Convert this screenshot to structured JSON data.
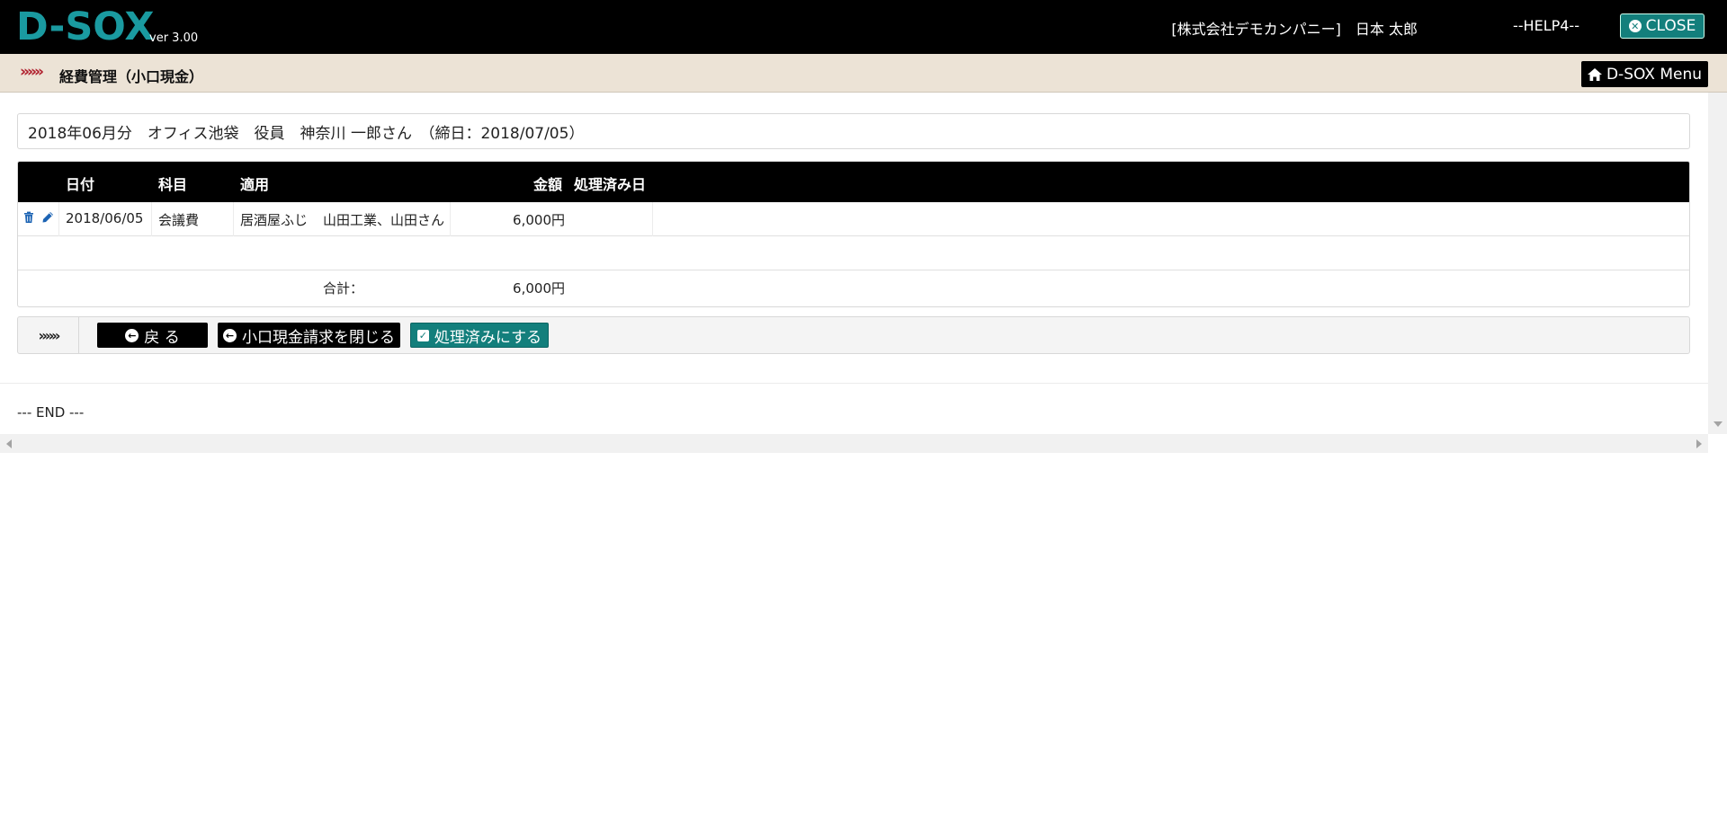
{
  "header": {
    "logo": "D-SOX",
    "version": "ver 3.00",
    "company_user": "[株式会社デモカンパニー]　日本 太郎",
    "help": "--HELP4--",
    "close_label": "CLOSE"
  },
  "breadcrumb": {
    "chevrons": "»»»",
    "title": "経費管理（小口現金）",
    "menu_label": "D-SOX Menu"
  },
  "summary": {
    "text": "2018年06月分　オフィス池袋　役員　神奈川 一郎さん　（締日：2018/07/05）"
  },
  "table": {
    "headers": {
      "date": "日付",
      "subject": "科目",
      "description": "適用",
      "amount": "金額",
      "processed_date": "処理済み日"
    },
    "rows": [
      {
        "date": "2018/06/05",
        "subject": "会議費",
        "description_1": "居酒屋ふじ",
        "description_2": "山田工業、山田さん",
        "amount": "6,000円",
        "processed_date": ""
      }
    ],
    "total_label": "合計：",
    "total_amount": "6,000円"
  },
  "actions": {
    "chevrons": "»»»",
    "back_label": "戻 る",
    "close_request_label": "小口現金請求を閉じる",
    "mark_processed_label": "処理済みにする"
  },
  "footer": {
    "end_text": "--- END ---"
  },
  "colors": {
    "logo": "#1a9aa0",
    "teal_button": "#137f7c",
    "breadcrumb_bg": "#ece3d6",
    "chevron_red": "#b0202e",
    "icon_blue": "#1d64b4"
  }
}
